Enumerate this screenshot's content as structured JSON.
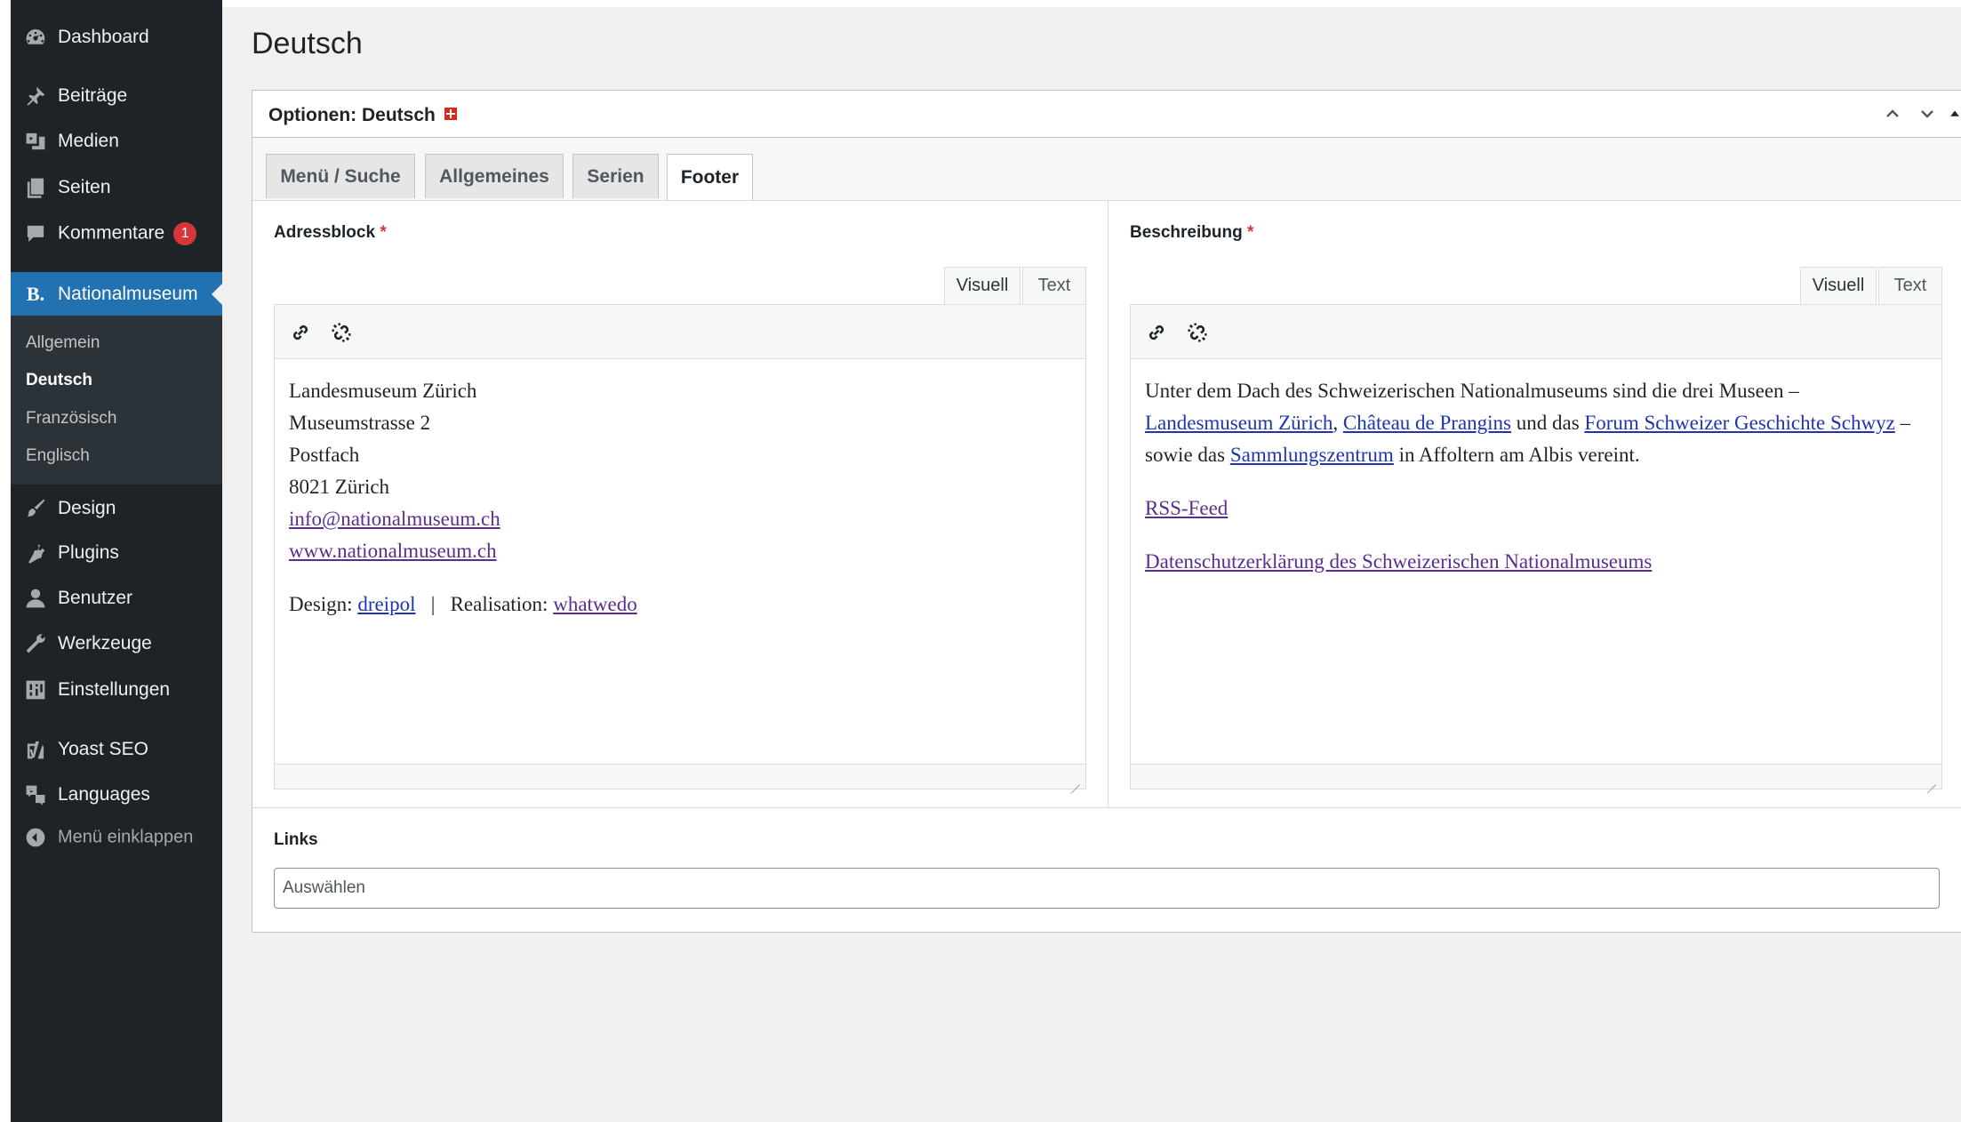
{
  "sidebar": {
    "items": [
      {
        "label": "Dashboard",
        "icon": "dashboard-icon"
      },
      {
        "label": "Beiträge",
        "icon": "pin-icon"
      },
      {
        "label": "Medien",
        "icon": "media-icon"
      },
      {
        "label": "Seiten",
        "icon": "pages-icon"
      },
      {
        "label": "Kommentare",
        "icon": "comment-icon",
        "badge": "1"
      },
      {
        "label": "Nationalmuseum",
        "icon": "b-logo-icon"
      },
      {
        "label": "Design",
        "icon": "brush-icon"
      },
      {
        "label": "Plugins",
        "icon": "plug-icon"
      },
      {
        "label": "Benutzer",
        "icon": "user-icon"
      },
      {
        "label": "Werkzeuge",
        "icon": "wrench-icon"
      },
      {
        "label": "Einstellungen",
        "icon": "settings-icon"
      },
      {
        "label": "Yoast SEO",
        "icon": "yoast-icon"
      },
      {
        "label": "Languages",
        "icon": "translation-icon"
      },
      {
        "label": "Menü einklappen",
        "icon": "collapse-icon"
      }
    ],
    "submenu": [
      "Allgemein",
      "Deutsch",
      "Französisch",
      "Englisch"
    ]
  },
  "page": {
    "title": "Deutsch"
  },
  "postbox": {
    "title": "Optionen: Deutsch",
    "tabs": [
      "Menü / Suche",
      "Allgemeines",
      "Serien",
      "Footer"
    ],
    "active_tab": "Footer"
  },
  "adressblock": {
    "label": "Adressblock",
    "required": "*",
    "tab_visual": "Visuell",
    "tab_text": "Text",
    "lines": [
      "Landesmuseum Zürich",
      "Museumstrasse 2",
      "Postfach",
      "8021 Zürich"
    ],
    "email": "info@nationalmuseum.ch",
    "website": "www.nationalmuseum.ch",
    "design_label": "Design:",
    "design_link": "dreipol",
    "separator": "|",
    "realisation_label": "Realisation:",
    "realisation_link": "whatwedo"
  },
  "beschreibung": {
    "label": "Beschreibung",
    "required": "*",
    "tab_visual": "Visuell",
    "tab_text": "Text",
    "intro": "Unter dem Dach des Schweizerischen Nationalmuseums sind die drei Museen –",
    "link1": "Landesmuseum Zürich",
    "comma": ",",
    "link2": "Château de Prangins",
    "und_das": "und das",
    "link3": "Forum Schweizer Geschichte Schwyz",
    "sowie": "– sowie das",
    "link4": "Sammlungszentrum",
    "outro": "in Affoltern am Albis vereint.",
    "rss": "RSS-Feed",
    "privacy": "Datenschutzerklärung des Schweizerischen Nationalmuseums"
  },
  "links": {
    "label": "Links",
    "placeholder": "Auswählen"
  },
  "colors": {
    "sidebar_bg": "#1d2327",
    "submenu_bg": "#2c3338",
    "accent": "#2271b1",
    "badge": "#d63638",
    "link": "#1f34b1",
    "visited_link": "#5c2d91"
  }
}
